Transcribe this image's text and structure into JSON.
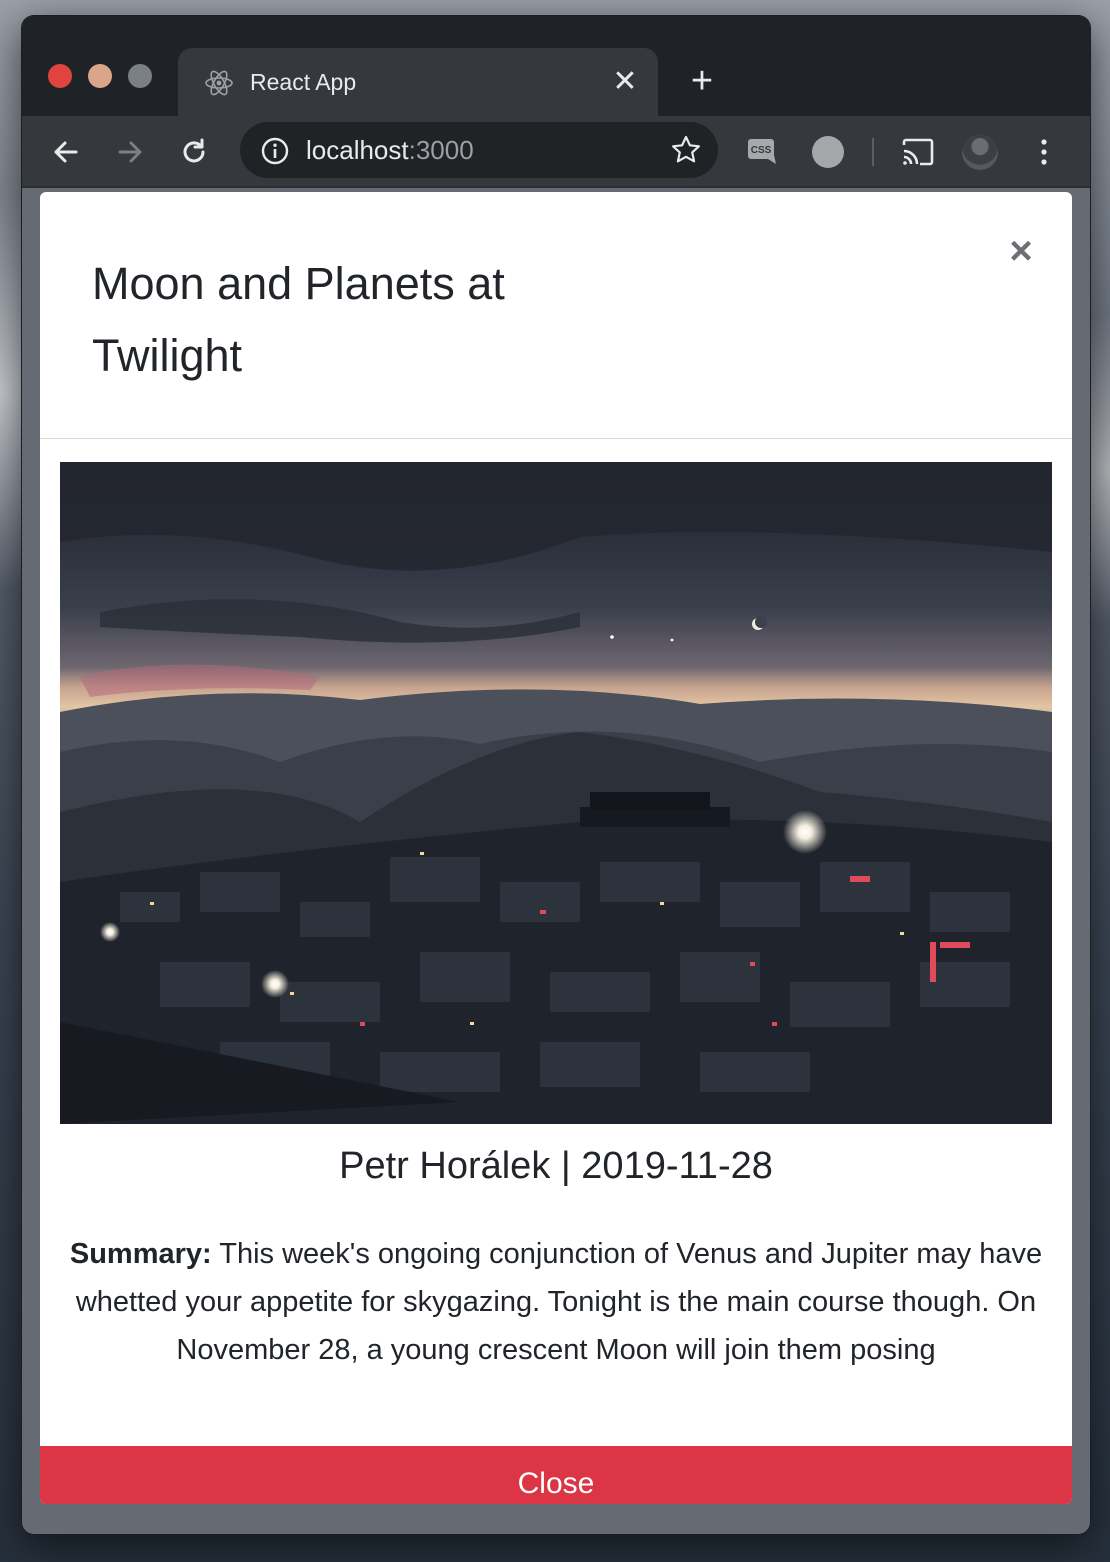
{
  "browser": {
    "tab": {
      "title": "React App",
      "favicon": "react-icon",
      "close_glyph": "✕"
    },
    "new_tab_glyph": "+",
    "address_bar": {
      "host": "localhost",
      "port": ":3000"
    },
    "toolbar_icons": [
      "back-arrow-icon",
      "forward-arrow-icon",
      "reload-icon",
      "info-icon",
      "star-icon",
      "css-extension-icon",
      "extension-icon",
      "cast-icon",
      "profile-avatar",
      "menu-icon"
    ]
  },
  "modal": {
    "title": "Moon and Planets at Twilight",
    "close_glyph": "×",
    "image": {
      "subject": "twilight landscape with crescent moon over a hillside town"
    },
    "credit": "Petr Horálek | 2019-11-28",
    "summary_label": "Summary:",
    "summary_text": "This week's ongoing conjunction of Venus and Jupiter may have whetted your appetite for skygazing. Tonight is the main course though. On November 28, a young crescent Moon will join them posing",
    "close_button": "Close"
  },
  "colors": {
    "close_button_bg": "#dc3545",
    "tabstrip_bg": "#1f2226",
    "toolbar_bg": "#35383d"
  }
}
